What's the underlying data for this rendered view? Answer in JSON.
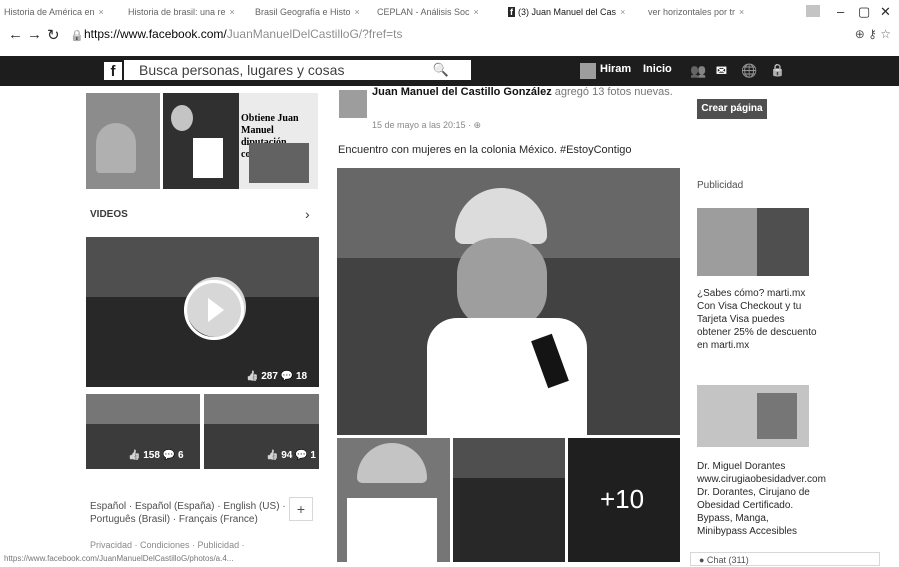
{
  "browser": {
    "tabs": [
      {
        "label": "Historia de América en",
        "left": 0
      },
      {
        "label": "Historia de brasil: una re",
        "left": 0
      },
      {
        "label": "Brasil Geografía e Histo",
        "left": 0
      },
      {
        "label": "CEPLAN - Análisis Soc",
        "left": 0
      },
      {
        "label": "(3) Juan Manuel del Cas",
        "left": 0
      },
      {
        "label": "ver horizontales por tr",
        "left": 0
      }
    ],
    "window_min": "–",
    "window_max": "▢",
    "window_close": "✕",
    "url_host": "https://www.facebook.com/",
    "url_rest": "JuanManuelDelCastilloG/?fref=ts"
  },
  "fb": {
    "search_placeholder": "Busca personas, lugares y cosas",
    "user_name": "Hiram",
    "home": "Inicio"
  },
  "left": {
    "photo_text_1": "Obtiene Juan Manuel",
    "photo_text_2": "diputación cordobesa",
    "videos_label": "VIDEOS",
    "video_likes": "287",
    "video_comments": "18",
    "thumb1_likes": "158",
    "thumb1_comments": "6",
    "thumb2_likes": "94",
    "thumb2_comments": "1",
    "languages": "Español · Español (España) · English (US) · Português (Brasil) · Français (France)",
    "footer": "Privacidad · Condiciones · Publicidad ·"
  },
  "post": {
    "author": "Juan Manuel del Castillo González",
    "action": "agregó 13 fotos nuevas.",
    "date": "15 de mayo a las 20:15 · ⊕",
    "caption": "Encuentro con mujeres en la colonia México. #EstoyContigo",
    "more_photos": "+10"
  },
  "right": {
    "create_page": "Crear página",
    "ads_title": "Publicidad",
    "ad1_text": "¿Sabes cómo? marti.mx Con Visa Checkout y tu Tarjeta Visa puedes obtener 25% de descuento en marti.mx",
    "ad2_text": "Dr. Miguel Dorantes www.cirugiaobesidadver.com Dr. Dorantes, Cirujano de Obesidad Certificado. Bypass, Manga, Minibypass Accesibles",
    "chat": "● Chat (311)"
  },
  "status_url": "https://www.facebook.com/JuanManuelDelCastilloG/photos/a.4..."
}
